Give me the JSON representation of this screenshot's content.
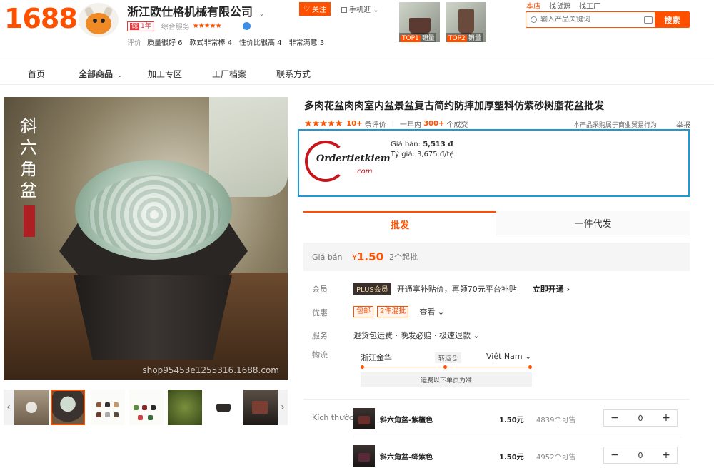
{
  "header": {
    "logo": "1688",
    "company_name": "浙江欧仕格机械有限公司",
    "company_chevron": "⌄",
    "years_badge_prefix": "诚",
    "years_badge": "1年",
    "service_label": "综合服务",
    "service_stars": "★★★★★",
    "follow_button": "关注",
    "mobile_label": "手机逛",
    "tags_label": "评价",
    "tags": [
      "质量很好 6",
      "款式非常棒 4",
      "性价比很高 4",
      "非常满意 3"
    ],
    "top_products": [
      {
        "rank": "TOP1",
        "label": "销量"
      },
      {
        "rank": "TOP2",
        "label": "销量"
      }
    ],
    "search_tabs": [
      "本店",
      "找货源",
      "找工厂"
    ],
    "search_placeholder": "输入产品关键词",
    "search_button": "搜索"
  },
  "nav": {
    "items": [
      "首页",
      "全部商品",
      "加工专区",
      "工厂档案",
      "联系方式"
    ],
    "dropdown_glyph": "︿"
  },
  "gallery": {
    "vertical_text": [
      "斜",
      "六",
      "角",
      "盆"
    ],
    "watermark": "shop95453e1255316.1688.com",
    "prev_arrow": "‹",
    "next_arrow": "›"
  },
  "product": {
    "title": "多肉花盆肉肉室内盆景盆复古简约防摔加厚塑料仿紫砂树脂花盆批发",
    "stars": "★★★★★",
    "review_count": "10+",
    "review_label": "条评价",
    "sales_prefix": "一年内",
    "sales_count": "300+",
    "sales_label": "个成交",
    "legal_note": "本产品采购属于商业贸易行为",
    "report": "举报"
  },
  "promo": {
    "logo_text": "Ordertietkiem",
    "logo_sub": ".com",
    "price_label": "Giá bán:",
    "price_value": "5,513 đ",
    "rate_label": "Tỷ giá:",
    "rate_value": "3,675 đ/tệ"
  },
  "mode_tabs": {
    "active": "批发",
    "inactive": "一件代发"
  },
  "price": {
    "label": "Giá bán",
    "currency": "¥",
    "value": "1.50",
    "moq": "2个起批"
  },
  "member": {
    "label": "会员",
    "badge": "PLUS会员",
    "text": "开通享补贴价，再领70元平台补贴",
    "open_link": "立即开通 ›"
  },
  "discount": {
    "label": "优惠",
    "tags": [
      "包邮",
      "2件混批"
    ],
    "more": "查看 ⌄"
  },
  "service": {
    "label": "服务",
    "text": "退货包运费 · 晚发必赔 · 极速退款 ⌄"
  },
  "logistics": {
    "label": "物流",
    "from": "浙江金华",
    "via": "转运仓",
    "to": "Việt Nam ⌄",
    "note": "运费以下单页为准"
  },
  "sku": {
    "label": "Kích thước",
    "items": [
      {
        "name": "斜六角盆-紫檀色",
        "price": "1.50元",
        "stock": "4839个可售",
        "qty": "0"
      },
      {
        "name": "斜六角盆-绛紫色",
        "price": "1.50元",
        "stock": "4952个可售",
        "qty": "0"
      }
    ],
    "minus": "−",
    "plus": "+"
  }
}
